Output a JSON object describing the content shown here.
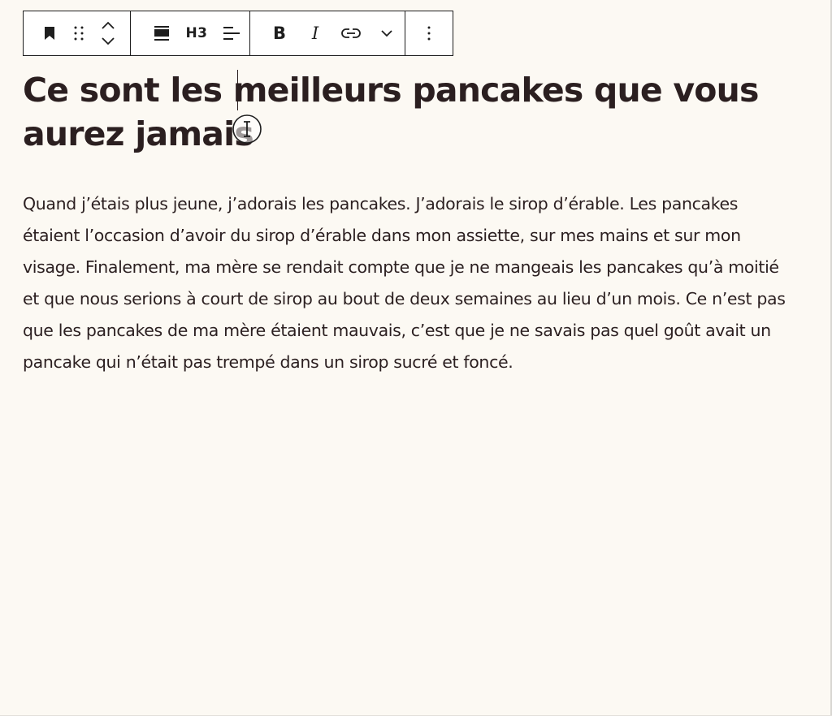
{
  "toolbar": {
    "block_type_icon": "bookmark-icon",
    "drag_icon": "drag-handle-icon",
    "move_up_icon": "chevron-up-icon",
    "move_down_icon": "chevron-down-icon",
    "align_icon": "align-wide-icon",
    "heading_level_label": "H3",
    "text_align_icon": "text-align-icon",
    "bold_label": "B",
    "italic_label": "I",
    "link_icon": "link-icon",
    "more_formats_icon": "chevron-down-icon",
    "options_icon": "vertical-ellipsis-icon"
  },
  "content": {
    "heading": "Ce sont les meilleurs pancakes que vous aurez jamais",
    "paragraph": "Quand j’étais plus jeune, j’adorais les pancakes. J’adorais le sirop d’érable. Les pancakes étaient l’occasion d’avoir du sirop d’érable dans mon assiette, sur mes mains et sur mon visage. Finalement, ma mère se rendait compte que je ne mangeais les pancakes qu’à moitié et que nous serions à court de sirop au bout de deux semaines au lieu d’un mois. Ce n’est pas que les pancakes de ma mère étaient mauvais, c’est que je ne savais pas quel goût avait un pancake qui n’était pas trempé dans un sirop sucré et foncé."
  },
  "colors": {
    "background": "#fcf9f3",
    "text": "#2b1f20",
    "toolbar_border": "#1e1e1e",
    "toolbar_background": "#ffffff"
  }
}
